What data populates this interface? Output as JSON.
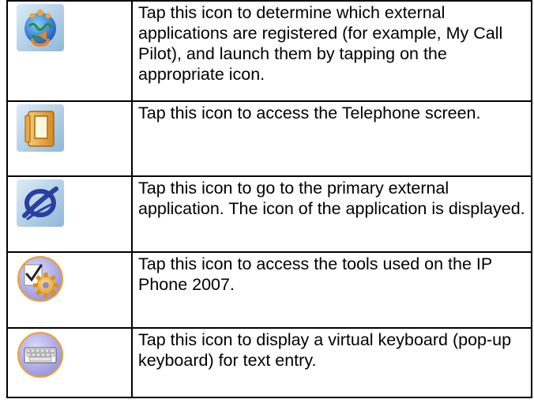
{
  "rows": [
    {
      "icon": "external-applications-icon",
      "text": "Tap this icon to determine which external applications are registered (for example, My Call Pilot), and launch them by tapping on the appropriate icon."
    },
    {
      "icon": "telephone-icon",
      "text": "Tap this icon to access the Telephone screen."
    },
    {
      "icon": "primary-application-icon",
      "text": "Tap this icon to go to the primary external application. The icon of the application is displayed."
    },
    {
      "icon": "tools-icon",
      "text": "Tap this icon to access the tools used on the IP Phone 2007."
    },
    {
      "icon": "keyboard-icon",
      "text": "Tap this icon to display a virtual keyboard (pop-up keyboard) for text entry."
    }
  ],
  "colors": {
    "tile_light": "#cfe3f2",
    "tile_dark": "#8fb7d8",
    "circle_lavender": "#a8a6e6",
    "accent_orange": "#f2a23a",
    "nortel_blue": "#2b3f9e"
  }
}
